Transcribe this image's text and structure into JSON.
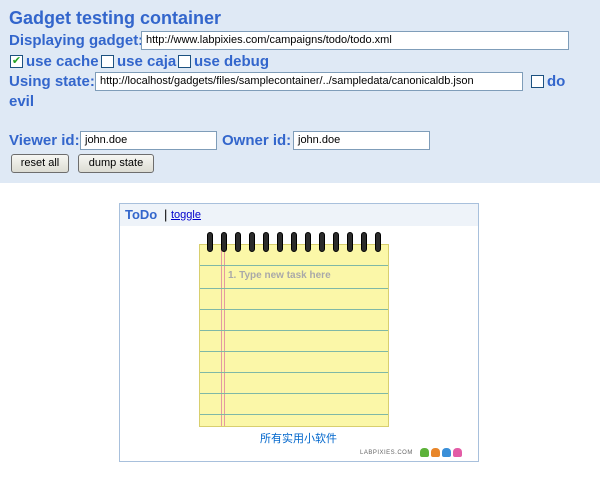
{
  "header": {
    "title": "Gadget testing container",
    "displaying_label": "Displaying gadget:",
    "gadget_url": "http://www.labpixies.com/campaigns/todo/todo.xml",
    "options": {
      "use_cache": {
        "label": "use cache",
        "checked": true
      },
      "use_caja": {
        "label": "use caja",
        "checked": false
      },
      "use_debug": {
        "label": "use debug",
        "checked": false
      }
    },
    "state_label": "Using state:",
    "state_url": "http://localhost/gadgets/files/samplecontainer/../sampledata/canonicaldb.json",
    "do_evil": {
      "label_line1": "do",
      "label_line2": "evil",
      "checked": false
    },
    "viewer_label": "Viewer id:",
    "viewer_value": "john.doe",
    "owner_label": "Owner id:",
    "owner_value": "john.doe",
    "reset_label": "reset all",
    "dump_label": "dump state"
  },
  "gadget": {
    "title": "ToDo",
    "separator": "|",
    "toggle_label": "toggle",
    "task_placeholder": "1. Type new task here",
    "footer_link": "所有实用小软件",
    "brand": "LABPIXIES.COM",
    "colors": {
      "title_blue": "#3366cc",
      "pad_yellow": "#fbf7a8",
      "pad_green": "#2f6b3c",
      "panel_bg": "#dfe9f5"
    }
  }
}
